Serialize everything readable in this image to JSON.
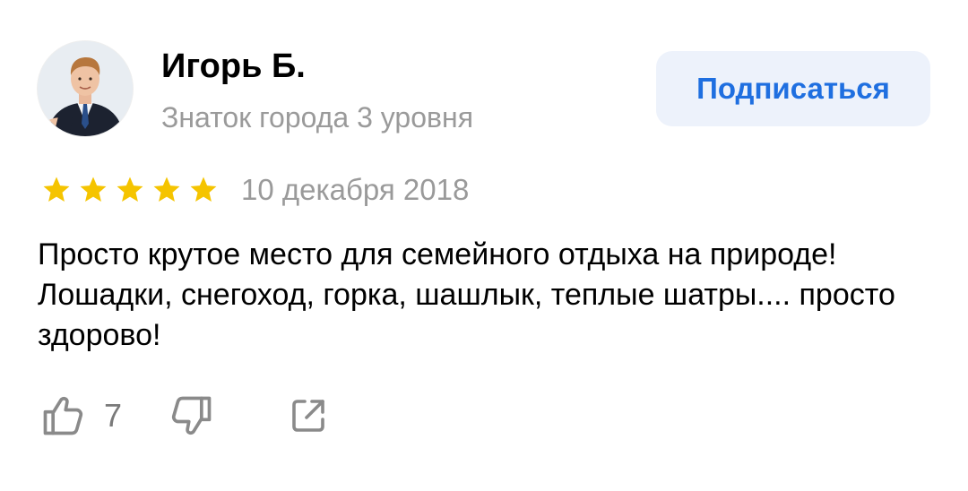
{
  "author": {
    "name": "Игорь Б.",
    "level": "Знаток города 3 уровня"
  },
  "subscribe": {
    "label": "Подписаться"
  },
  "review": {
    "rating": 5,
    "rating_max": 5,
    "date": "10 декабря 2018",
    "text": "Просто крутое место для семейного отдыха на природе! Лошадки, снегоход, горка, шашлык, теплые шатры.... просто здорово!"
  },
  "actions": {
    "like_count": "7",
    "like_icon": "thumbs-up-icon",
    "dislike_icon": "thumbs-down-icon",
    "share_icon": "share-icon"
  },
  "colors": {
    "star": "#f5c400",
    "subscribe_text": "#1f6fe0",
    "subscribe_bg": "#edf2fb",
    "secondary_text": "#9a9a9a",
    "icon_gray": "#8a8a8a"
  }
}
